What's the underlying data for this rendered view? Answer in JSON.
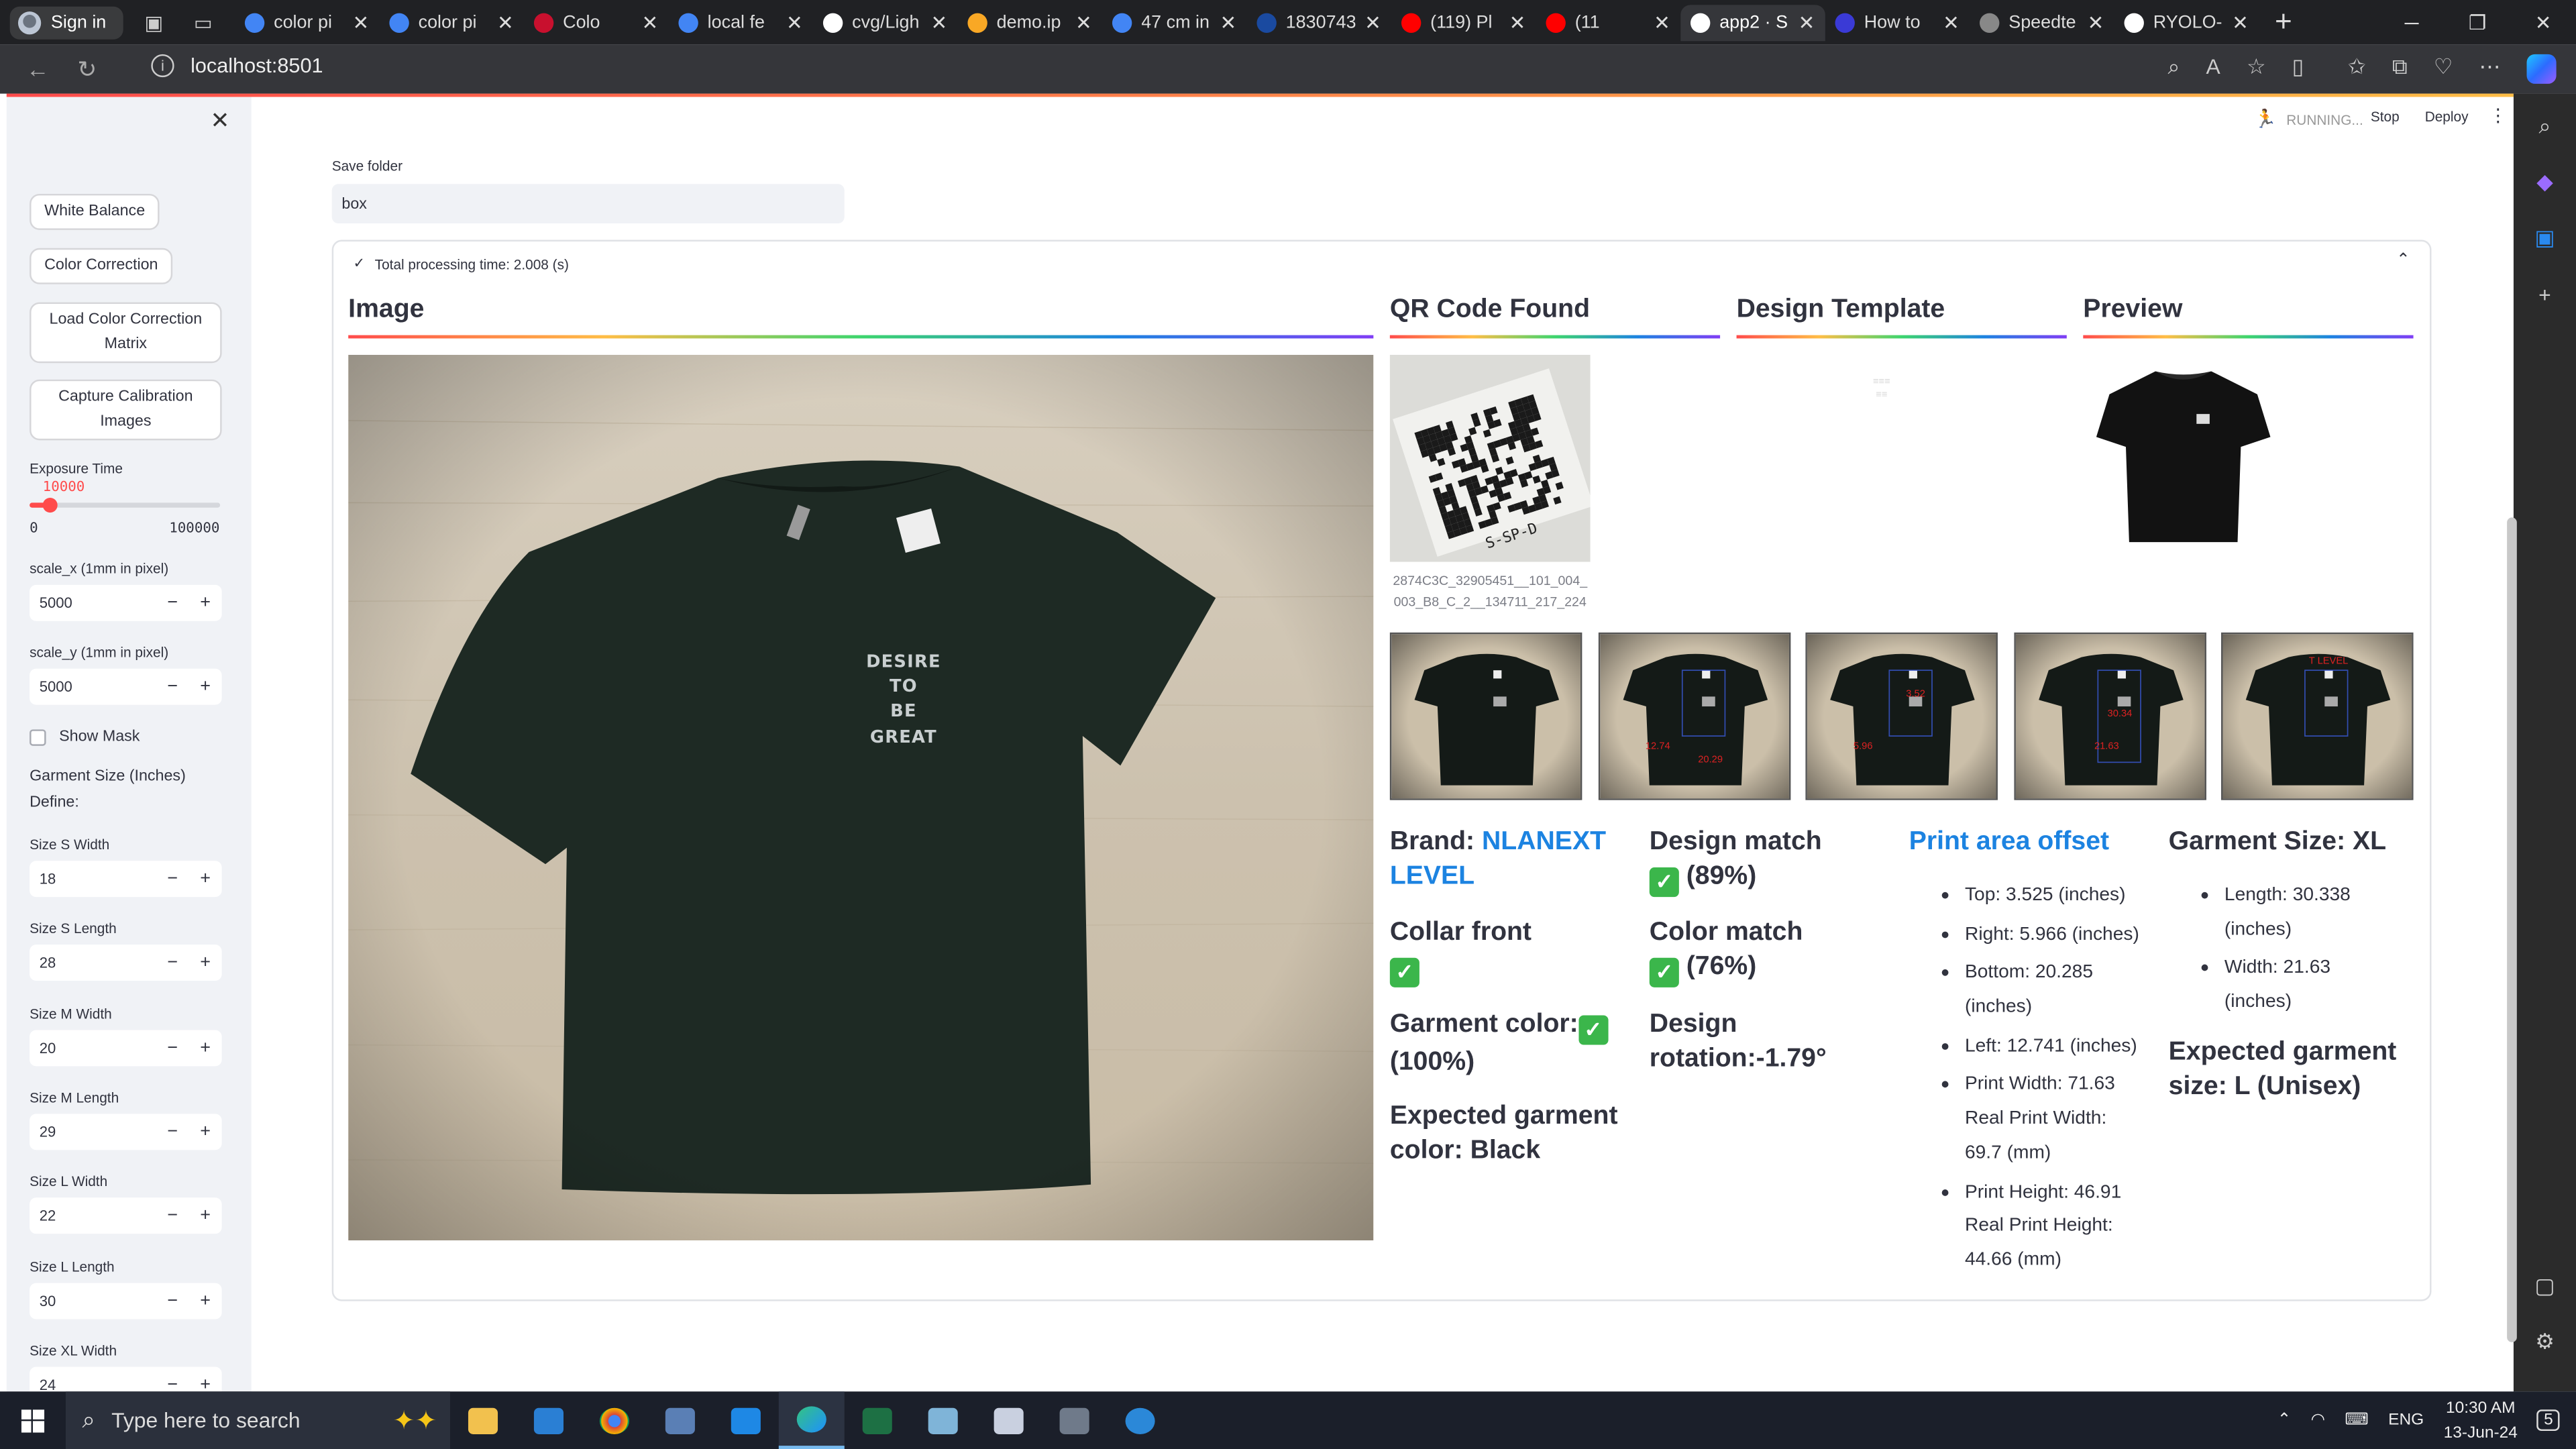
{
  "browser": {
    "profile_label": "Sign in",
    "tabs": [
      {
        "title": "color pi",
        "fav": "#4285f4"
      },
      {
        "title": "color pi",
        "fav": "#4285f4"
      },
      {
        "title": "Colo",
        "fav": "#c8102e"
      },
      {
        "title": "local fe",
        "fav": "#4285f4"
      },
      {
        "title": "cvg/Ligh",
        "fav": "#ffffff"
      },
      {
        "title": "demo.ip",
        "fav": "#f9a825"
      },
      {
        "title": "47 cm in",
        "fav": "#4285f4"
      },
      {
        "title": "1830743",
        "fav": "#1a4aa0"
      },
      {
        "title": "(119) Pl",
        "fav": "#ff0000"
      },
      {
        "title": "(11",
        "fav": "#ff0000"
      },
      {
        "title": "app2 · S",
        "fav": "#ffffff"
      },
      {
        "title": "How to",
        "fav": "#3a3ad6"
      },
      {
        "title": "Speedte",
        "fav": "#888888"
      },
      {
        "title": "RYOLO-",
        "fav": "#ffffff"
      }
    ],
    "active_tab_index": 10,
    "url": "localhost:8501"
  },
  "sidebar": {
    "buttons": [
      "White Balance",
      "Color Correction",
      "Load Color Correction Matrix",
      "Capture Calibration Images"
    ],
    "exposure": {
      "label": "Exposure Time",
      "value": "10000",
      "min": "0",
      "max": "100000",
      "fraction": 0.1
    },
    "scale_x": {
      "label": "scale_x (1mm in pixel)",
      "value": "5000"
    },
    "scale_y": {
      "label": "scale_y (1mm in pixel)",
      "value": "5000"
    },
    "show_mask": "Show Mask",
    "garment_size_title": "Garment Size (Inches)",
    "define_label": "Define:",
    "sizes": [
      {
        "label": "Size S Width",
        "value": "18"
      },
      {
        "label": "Size S Length",
        "value": "28"
      },
      {
        "label": "Size M Width",
        "value": "20"
      },
      {
        "label": "Size M Length",
        "value": "29"
      },
      {
        "label": "Size L Width",
        "value": "22"
      },
      {
        "label": "Size L Length",
        "value": "30"
      },
      {
        "label": "Size XL Width",
        "value": "24"
      }
    ],
    "minus": "−",
    "plus": "+"
  },
  "header": {
    "status": "RUNNING...",
    "stop": "Stop",
    "deploy": "Deploy"
  },
  "save_folder": {
    "label": "Save folder",
    "value": "box"
  },
  "expander": {
    "title": "Total processing time: 2.008 (s)"
  },
  "columns": {
    "image": "Image",
    "qr": "QR Code Found",
    "design": "Design Template",
    "preview": "Preview"
  },
  "shirt_print": [
    "DESIRE TO",
    "BE GREAT"
  ],
  "qr_caption": "2874C3C_32905451__101_004_003_B8_C_2__134711_217_224",
  "qr_text": "S-SP-D",
  "thumb_labels": [
    {
      "a": "",
      "b": ""
    },
    {
      "a": "12.74",
      "b": "20.29"
    },
    {
      "a": "5.96",
      "b": "3.52"
    },
    {
      "a": "30.34",
      "b": "21.63"
    },
    {
      "a": "T LEVEL",
      "b": ""
    }
  ],
  "results": {
    "brand_label": "Brand: ",
    "brand_value": "NLANEXT LEVEL",
    "collar": "Collar front",
    "garment_color": "Garment color:",
    "garment_color_pct": "(100%)",
    "expected_color": "Expected garment color: Black",
    "design_match": "Design match",
    "design_match_pct": "(89%)",
    "color_match": "Color match",
    "color_match_pct": "(76%)",
    "design_rotation": "Design rotation:-1.79°",
    "print_area_title": "Print area offset",
    "print_area_items": [
      "Top: 3.525 (inches)",
      "Right: 5.966 (inches)",
      "Bottom: 20.285 (inches)",
      "Left: 12.741 (inches)",
      "Print Width: 71.63 Real Print Width: 69.7 (mm)",
      "Print Height: 46.91 Real Print Height: 44.66 (mm)"
    ],
    "garment_size_title": "Garment Size: XL",
    "garment_size_items": [
      "Length: 30.338 (inches)",
      "Width: 21.63 (inches)"
    ],
    "expected_size": "Expected garment size: L (Unisex)"
  },
  "taskbar": {
    "search_placeholder": "Type here to search",
    "lang": "ENG",
    "time": "10:30 AM",
    "date": "13-Jun-24",
    "notif_count": "5"
  }
}
